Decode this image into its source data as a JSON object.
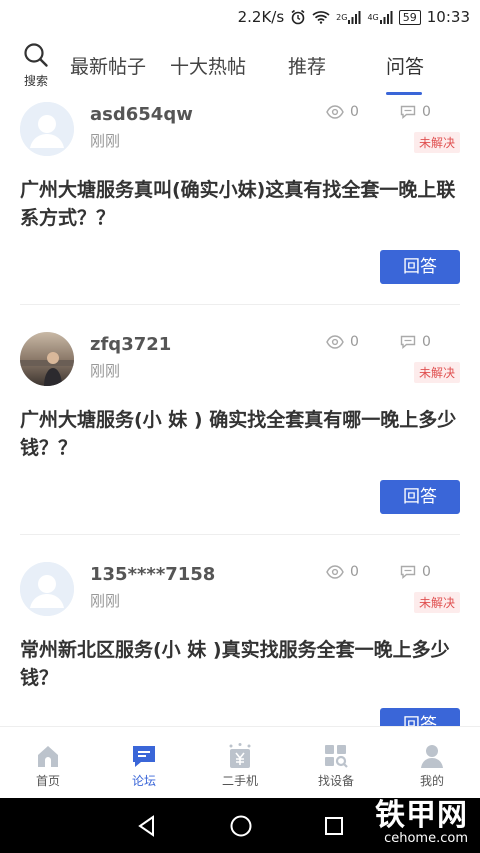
{
  "status_bar": {
    "speed": "2.2K/s",
    "net2g": "2G",
    "net4g": "4G",
    "battery": "59",
    "time": "10:33"
  },
  "header": {
    "search_label": "搜索",
    "tabs": [
      {
        "label": "最新帖子"
      },
      {
        "label": "十大热帖"
      },
      {
        "label": "推荐"
      },
      {
        "label": "问答"
      }
    ],
    "active_tab": 3,
    "accent_color": "#3a66d8"
  },
  "posts": [
    {
      "username": "asd654qw",
      "time": "刚刚",
      "views": "0",
      "comments": "0",
      "status": "未解决",
      "title": "广州大塘服务真叫(确实小妹)这真有找全套一晚上联系方式？？",
      "answer_label": "回答"
    },
    {
      "username": "zfq3721",
      "time": "刚刚",
      "views": "0",
      "comments": "0",
      "status": "未解决",
      "title": "广州大塘服务(小 妹 ) 确实找全套真有哪一晚上多少钱？？",
      "answer_label": "回答"
    },
    {
      "username": "135****7158",
      "time": "刚刚",
      "views": "0",
      "comments": "0",
      "status": "未解决",
      "title": "常州新北区服务(小 妹 )真实找服务全套一晚上多少钱？",
      "answer_label": "回答"
    }
  ],
  "bottom_nav": [
    {
      "label": "首页",
      "icon": "home-icon"
    },
    {
      "label": "论坛",
      "icon": "forum-icon"
    },
    {
      "label": "二手机",
      "icon": "second-hand-icon"
    },
    {
      "label": "找设备",
      "icon": "find-equipment-icon"
    },
    {
      "label": "我的",
      "icon": "profile-icon"
    }
  ],
  "watermark": {
    "brand": "铁甲网",
    "domain": "cehome.com"
  }
}
